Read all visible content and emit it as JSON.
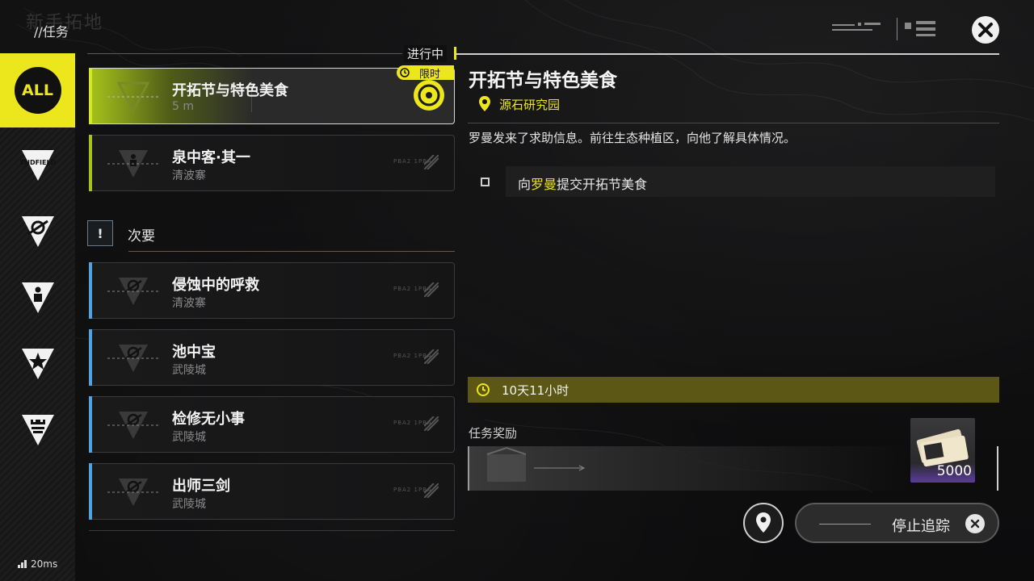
{
  "header": {
    "title": "//任务",
    "logo_text": "新手拓地"
  },
  "sidebar": {
    "items": [
      {
        "name": "all",
        "label": "ALL",
        "active": true
      },
      {
        "name": "endfield",
        "label": "ENDFIELD"
      },
      {
        "name": "type-2"
      },
      {
        "name": "type-3"
      },
      {
        "name": "type-4"
      },
      {
        "name": "type-5"
      }
    ]
  },
  "status": {
    "ping": "20ms"
  },
  "quest_list": {
    "in_progress_label": "进行中",
    "active": {
      "name": "开拓节与特色美食",
      "distance": "5 m",
      "timed_label": "限时"
    },
    "main_quests": [
      {
        "name": "泉中客·其一",
        "location": "清波寨",
        "tag": "PBA2 1PBA"
      }
    ],
    "minor_section_label": "次要",
    "minor_icon": "!",
    "minor_quests": [
      {
        "name": "侵蚀中的呼救",
        "location": "清波寨",
        "tag": "PBA2 1PBA"
      },
      {
        "name": "池中宝",
        "location": "武陵城",
        "tag": "PBA2 1PBA"
      },
      {
        "name": "检修无小事",
        "location": "武陵城",
        "tag": "PBA2 1PBA"
      },
      {
        "name": "出师三剑",
        "location": "武陵城",
        "tag": "PBA2 1PBA"
      }
    ]
  },
  "detail": {
    "title": "开拓节与特色美食",
    "location": "源石研究园",
    "description": "罗曼发来了求助信息。前往生态种植区，向他了解具体情况。",
    "objective_prefix": "向",
    "objective_highlight": "罗曼",
    "objective_suffix": "提交开拓节美食",
    "timer": "10天11小时",
    "reward_label": "任务奖励",
    "reward_qty": "5000",
    "stop_tracking_label": "停止追踪"
  },
  "colors": {
    "accent": "#ece61c",
    "active_green": "#a5c31a",
    "minor_stripe": "#4fa3e0",
    "main_stripe": "#a5c31a"
  }
}
